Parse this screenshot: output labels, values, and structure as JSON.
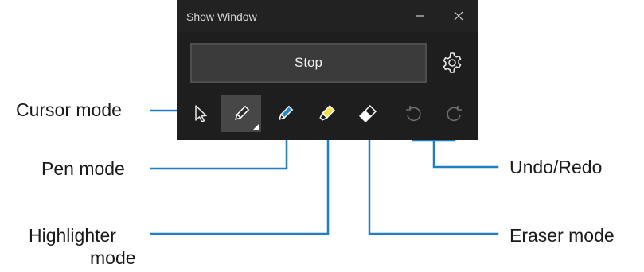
{
  "window": {
    "title": "Show Window",
    "minimize_glyph": "–",
    "close_glyph": "✕",
    "stop_label": "Stop"
  },
  "tools": [
    {
      "name": "cursor-mode",
      "icon": "cursor-icon"
    },
    {
      "name": "pen-black",
      "icon": "pen-icon",
      "color": "#2b2b2b",
      "selected": true
    },
    {
      "name": "pen-mode",
      "icon": "pen-icon",
      "color": "#1f8ad6"
    },
    {
      "name": "highlighter-mode",
      "icon": "highlighter-icon",
      "color": "#f2e04a"
    },
    {
      "name": "eraser-mode",
      "icon": "eraser-icon"
    },
    {
      "name": "undo",
      "icon": "undo-icon"
    },
    {
      "name": "redo",
      "icon": "redo-icon"
    }
  ],
  "callouts": {
    "cursor_mode": "Cursor mode",
    "pen_mode": "Pen mode",
    "highlighter_mode_line1": "Highlighter",
    "highlighter_mode_line2": "mode",
    "undo_redo": "Undo/Redo",
    "eraser_mode": "Eraser mode"
  },
  "colors": {
    "window_bg": "#1e1e1e",
    "leader_line": "#1f7fc4",
    "pen_blue": "#1f8ad6",
    "highlighter_yellow": "#f2e04a"
  }
}
